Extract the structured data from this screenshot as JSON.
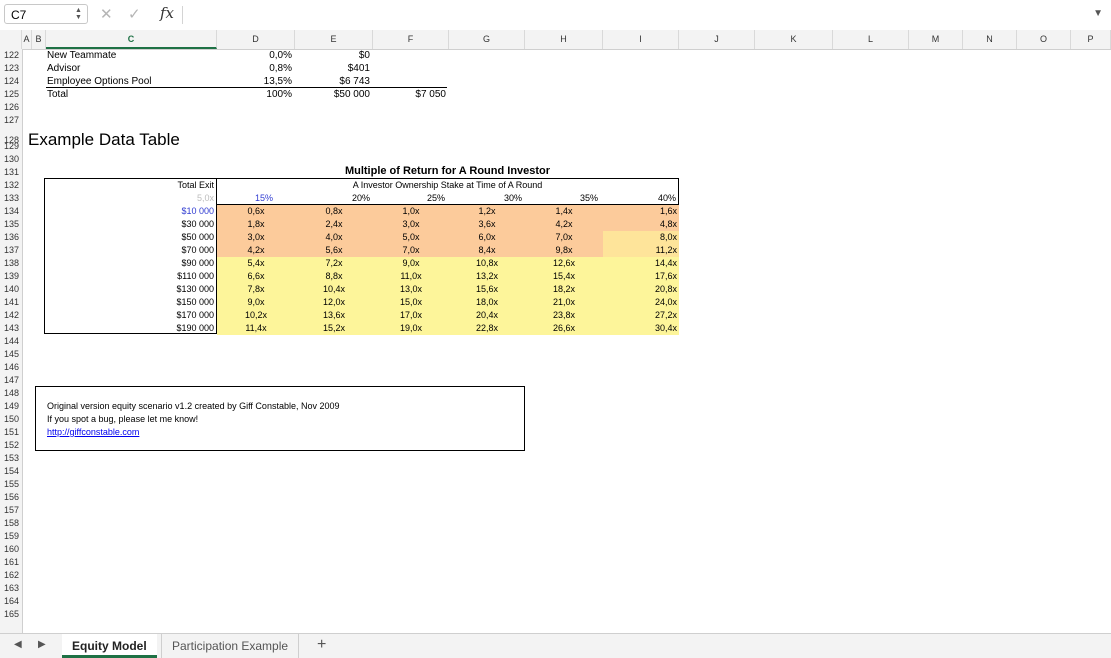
{
  "formula_bar": {
    "name_box": "C7",
    "formula": ""
  },
  "columns": [
    "A",
    "B",
    "C",
    "D",
    "E",
    "F",
    "G",
    "H",
    "I",
    "J",
    "K",
    "L",
    "M",
    "N",
    "O",
    "P"
  ],
  "rows": [
    "122",
    "123",
    "124",
    "125",
    "126",
    "127",
    "128",
    "129",
    "130",
    "131",
    "132",
    "133",
    "134",
    "135",
    "136",
    "137",
    "138",
    "139",
    "140",
    "141",
    "142",
    "143",
    "144",
    "145",
    "146",
    "147",
    "148",
    "149",
    "150",
    "151",
    "152",
    "153",
    "154",
    "155",
    "156",
    "157",
    "158",
    "159",
    "160",
    "161",
    "162",
    "163",
    "164",
    "165"
  ],
  "cap_table": [
    {
      "label": "New Teammate",
      "pct": "0,0%",
      "amount": "$0"
    },
    {
      "label": "Advisor",
      "pct": "0,8%",
      "amount": "$401"
    },
    {
      "label": "Employee Options Pool",
      "pct": "13,5%",
      "amount": "$6 743"
    },
    {
      "label": "Total",
      "pct": "100%",
      "amount": "$50 000",
      "extra": "$7 050"
    }
  ],
  "section_title": "Example Data Table",
  "data_table": {
    "title": "Multiple of Return for A Round Investor",
    "subtitle": "A Investor Ownership Stake at Time of A Round",
    "total_exit_label": "Total Exit",
    "corner_value": "5,0x",
    "percents": [
      "15%",
      "20%",
      "25%",
      "30%",
      "35%",
      "40%"
    ],
    "exits": [
      "$10 000",
      "$30 000",
      "$50 000",
      "$70 000",
      "$90 000",
      "$110 000",
      "$130 000",
      "$150 000",
      "$170 000",
      "$190 000"
    ],
    "values": [
      [
        "0,6x",
        "0,8x",
        "1,0x",
        "1,2x",
        "1,4x",
        "1,6x"
      ],
      [
        "1,8x",
        "2,4x",
        "3,0x",
        "3,6x",
        "4,2x",
        "4,8x"
      ],
      [
        "3,0x",
        "4,0x",
        "5,0x",
        "6,0x",
        "7,0x",
        "8,0x"
      ],
      [
        "4,2x",
        "5,6x",
        "7,0x",
        "8,4x",
        "9,8x",
        "11,2x"
      ],
      [
        "5,4x",
        "7,2x",
        "9,0x",
        "10,8x",
        "12,6x",
        "14,4x"
      ],
      [
        "6,6x",
        "8,8x",
        "11,0x",
        "13,2x",
        "15,4x",
        "17,6x"
      ],
      [
        "7,8x",
        "10,4x",
        "13,0x",
        "15,6x",
        "18,2x",
        "20,8x"
      ],
      [
        "9,0x",
        "12,0x",
        "15,0x",
        "18,0x",
        "21,0x",
        "24,0x"
      ],
      [
        "10,2x",
        "13,6x",
        "17,0x",
        "20,4x",
        "23,8x",
        "27,2x"
      ],
      [
        "11,4x",
        "15,2x",
        "19,0x",
        "22,8x",
        "26,6x",
        "30,4x"
      ]
    ],
    "colors": {
      "low": "#fccb9b",
      "high": "#fdf59a",
      "highlight": "#fee49a",
      "accent_blue": "#2f3bd1"
    }
  },
  "note": {
    "line1": "Original version equity scenario v1.2 created by Giff Constable, Nov 2009",
    "line2": "If you spot a bug, please let me know!",
    "link": "http://giffconstable.com"
  },
  "tabs": [
    "Equity Model",
    "Participation Example"
  ],
  "add_tab_label": "+"
}
